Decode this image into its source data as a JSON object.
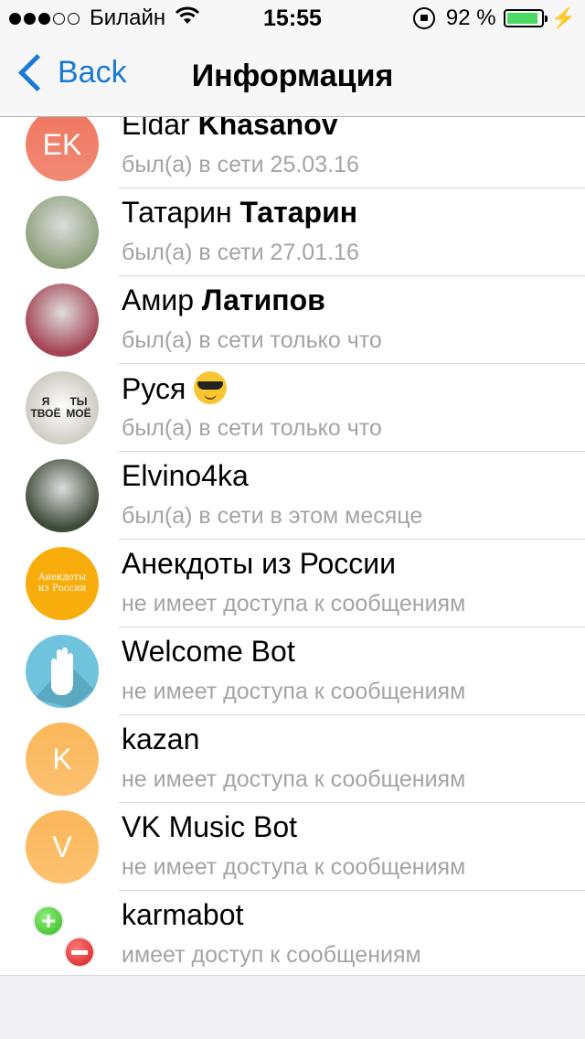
{
  "status_bar": {
    "carrier": "Билайн",
    "time": "15:55",
    "battery": "92 %",
    "battery_level": 0.92,
    "signal_dots": 5,
    "signal_filled": 3
  },
  "nav": {
    "back_label": "Back",
    "title": "Информация"
  },
  "members": [
    {
      "first": "Eldar",
      "last": "Khasanov",
      "status": "был(а) в сети 25.03.16",
      "avatar": "initials",
      "initials": "EK",
      "color": "#ef7760"
    },
    {
      "first": "Татарин",
      "last": "Татарин",
      "status": "был(а) в сети 27.01.16",
      "avatar": "photo",
      "color": "#8fa17c"
    },
    {
      "first": "Амир",
      "last": "Латипов",
      "status": "был(а) в сети только что",
      "avatar": "photo",
      "color": "#a64455"
    },
    {
      "first": "Руся",
      "last": "",
      "emoji": "😎",
      "status": "был(а) в сети только что",
      "avatar": "photo",
      "photo_texts": [
        "Я ТВОЁ",
        "ТЫ МОЁ"
      ],
      "color": "#c9c5bd"
    },
    {
      "first": "Elvino4ka",
      "last": "",
      "status": "был(а) в сети в этом месяце",
      "avatar": "photo",
      "color": "#3d4a38"
    },
    {
      "first": "Анекдоты из России",
      "last": "",
      "status": "не имеет доступа к сообщениям",
      "avatar": "logo",
      "logo_text": "Анекдоты из России",
      "color": "#f8ad0d"
    },
    {
      "first": "Welcome Bot",
      "last": "",
      "status": "не имеет доступа к сообщениям",
      "avatar": "hand",
      "color": "#6fc3dc"
    },
    {
      "first": "kazan",
      "last": "",
      "status": "не имеет доступа к сообщениям",
      "avatar": "initials",
      "initials": "K",
      "color": "#fbb75a"
    },
    {
      "first": "VK Music Bot",
      "last": "",
      "status": "не имеет доступа к сообщениям",
      "avatar": "initials",
      "initials": "V",
      "color": "#fbb75a"
    },
    {
      "first": "karmabot",
      "last": "",
      "status": "имеет доступ к сообщениям",
      "avatar": "karma",
      "color": "#4cd964"
    }
  ]
}
